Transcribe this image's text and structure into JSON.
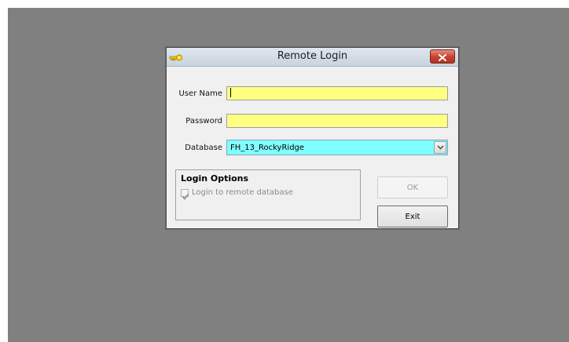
{
  "window": {
    "title": "Remote Login"
  },
  "form": {
    "user_name_label": "User Name",
    "user_name_value": "",
    "password_label": "Password",
    "password_value": "",
    "database_label": "Database",
    "database_value": "FH_13_RockyRidge"
  },
  "login_options": {
    "title": "Login Options",
    "remote_database_label": "Login to remote database",
    "remote_database_checked": true
  },
  "buttons": {
    "ok_label": "OK",
    "exit_label": "Exit"
  },
  "colors": {
    "required_field": "#ffff80",
    "database_field": "#80ffff",
    "desktop": "#808080",
    "close_button": "#c6402f"
  },
  "icons": {
    "title_icon": "key-icon",
    "close_icon": "close-icon",
    "dropdown_icon": "chevron-down-icon",
    "checkbox_icon": "checkmark-icon"
  }
}
